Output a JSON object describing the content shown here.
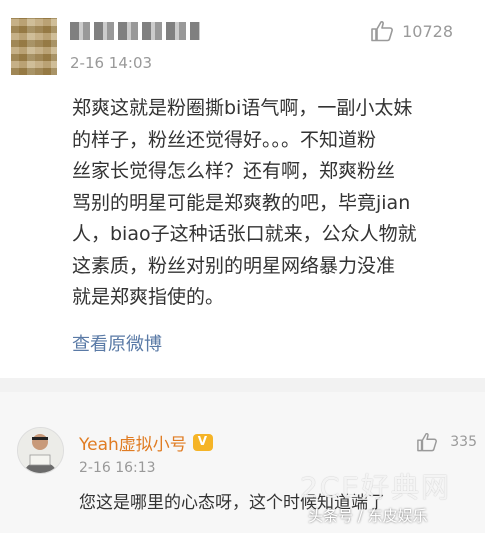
{
  "comment1": {
    "date": "2-16 14:03",
    "likes": "10728",
    "lines": [
      "郑爽这就是粉圈撕bi语气啊，一副小太妹",
      "的样子，粉丝还觉得好。。。不知道粉",
      "丝家长觉得怎么样？还有啊，郑爽粉丝",
      "骂别的明星可能是郑爽教的吧，毕竟jian",
      "人，biao子这种话张口就来，公众人物就",
      "这素质，粉丝对别的明星网络暴力没准",
      "就是郑爽指使的。"
    ],
    "view_link": "查看原微博"
  },
  "comment2": {
    "username": "Yeah虚拟小号",
    "date": "2-16 16:13",
    "likes": "335",
    "text": "您这是哪里的心态呀，这个时候知道端了"
  },
  "watermark": {
    "line1": "2CE好典网",
    "line2": "头条号 / 东皮娱乐"
  },
  "icons": {
    "like": "thumbs-up-icon",
    "badge": "vip-crown-icon"
  }
}
